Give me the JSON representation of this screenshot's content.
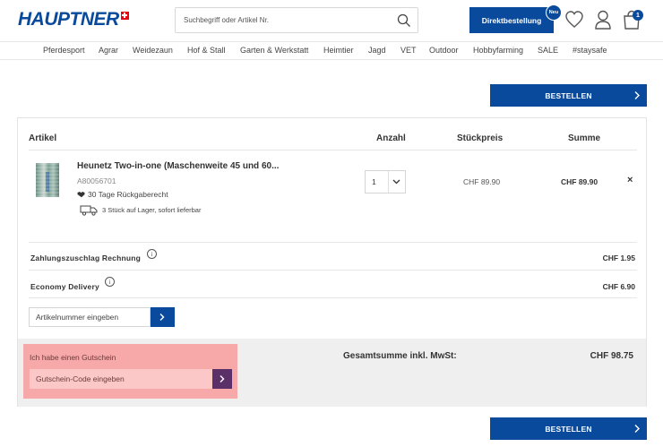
{
  "header": {
    "logo_text": "HAUPTNER",
    "search_placeholder": "Suchbegriff oder Artikel Nr.",
    "direct_order_label": "Direktbestellung",
    "new_badge": "Neu",
    "cart_count": "1"
  },
  "nav": {
    "items": [
      "Pferdesport",
      "Agrar",
      "Weidezaun",
      "Hof & Stall",
      "Garten & Werkstatt",
      "Heimtier",
      "Jagd",
      "VET",
      "Outdoor",
      "Hobbyfarming",
      "SALE",
      "#staysafe"
    ]
  },
  "order_button_label": "BESTELLEN",
  "table": {
    "headers": {
      "article": "Artikel",
      "quantity": "Anzahl",
      "unit_price": "Stückpreis",
      "sum": "Summe"
    }
  },
  "item": {
    "name": "Heunetz Two-in-one (Maschenweite 45 und 60...",
    "article_number": "A80056701",
    "return_policy": "30 Tage Rückgaberecht",
    "stock": "3 Stück auf Lager, sofort lieferbar",
    "quantity": "1",
    "unit_price": "CHF 89.90",
    "total": "CHF 89.90",
    "remove_symbol": "×"
  },
  "fees": [
    {
      "label": "Zahlungszuschlag Rechnung",
      "value": "CHF 1.95"
    },
    {
      "label": "Economy Delivery",
      "value": "CHF 6.90"
    }
  ],
  "info_symbol": "i",
  "article_input_placeholder": "Artikelnummer eingeben",
  "voucher": {
    "title": "Ich habe einen Gutschein",
    "placeholder": "Gutschein-Code eingeben"
  },
  "summary": {
    "label": "Gesamtsumme inkl. MwSt:",
    "value": "CHF 98.75"
  },
  "colors": {
    "brand_blue": "#0a4a9c",
    "swiss_red": "#e30613",
    "voucher_highlight": "#f7a8a8",
    "voucher_button": "#5b3068"
  }
}
